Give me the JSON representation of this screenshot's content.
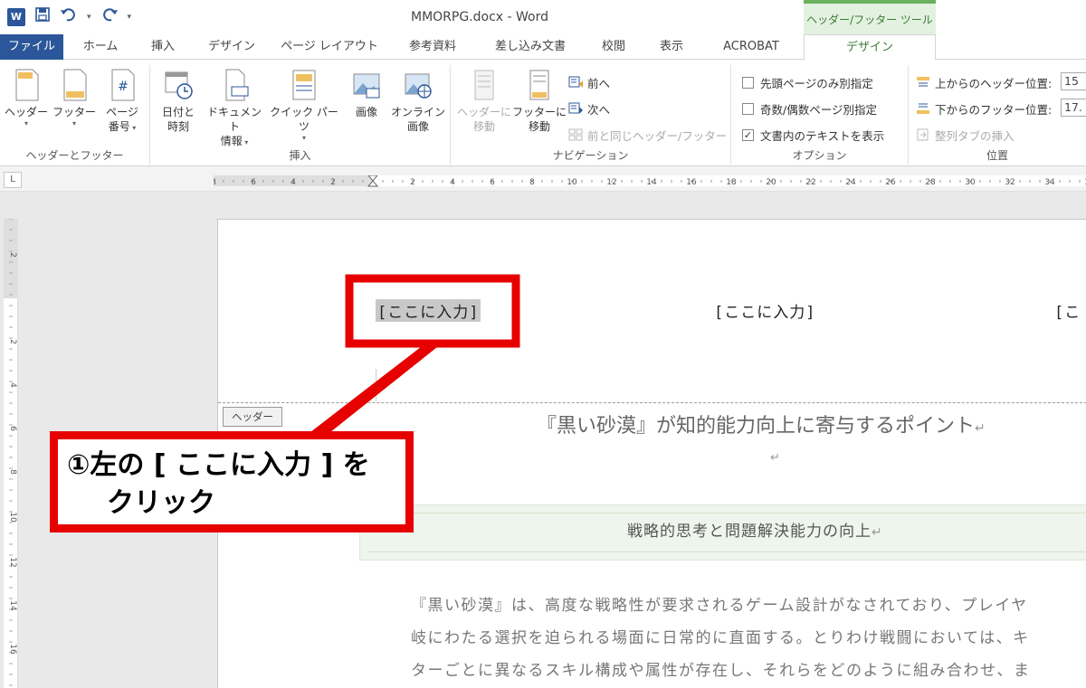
{
  "titlebar": {
    "app_icon": "W",
    "doc_title": "MMORPG.docx - Word",
    "context_title": "ヘッダー/フッター ツール"
  },
  "tabs": [
    {
      "label": "ファイル"
    },
    {
      "label": "ホーム"
    },
    {
      "label": "挿入"
    },
    {
      "label": "デザイン"
    },
    {
      "label": "ページ レイアウト"
    },
    {
      "label": "参考資料"
    },
    {
      "label": "差し込み文書"
    },
    {
      "label": "校閲"
    },
    {
      "label": "表示"
    },
    {
      "label": "ACROBAT"
    },
    {
      "label": "デザイン"
    }
  ],
  "ribbon": {
    "group_hf": {
      "label": "ヘッダーとフッター",
      "header": "ヘッダー",
      "footer": "フッター",
      "page_num_1": "ページ",
      "page_num_2": "番号"
    },
    "group_insert": {
      "label": "挿入",
      "datetime_1": "日付と",
      "datetime_2": "時刻",
      "docinfo_1": "ドキュメント",
      "docinfo_2": "情報",
      "quickparts": "クイック パーツ",
      "picture": "画像",
      "online_1": "オンライン",
      "online_2": "画像"
    },
    "group_nav": {
      "label": "ナビゲーション",
      "goto_header_1": "ヘッダーに",
      "goto_header_2": "移動",
      "goto_footer_1": "フッターに",
      "goto_footer_2": "移動",
      "prev": "前へ",
      "next": "次へ",
      "link_prev": "前と同じヘッダー/フッター"
    },
    "group_options": {
      "label": "オプション",
      "diff_first": "先頭ページのみ別指定",
      "diff_odd_even": "奇数/偶数ページ別指定",
      "show_text": "文書内のテキストを表示",
      "show_text_check": "✓"
    },
    "group_position": {
      "label": "位置",
      "header_pos": "上からのヘッダー位置:",
      "header_val": "15",
      "footer_pos": "下からのフッター位置:",
      "footer_val": "17.",
      "align_tab": "整列タブの挿入"
    }
  },
  "ruler": {
    "corner": "L",
    "h_labels": [
      "8",
      "6",
      "4",
      "2",
      "2",
      "4",
      "6",
      "8",
      "10",
      "12",
      "14",
      "16",
      "18",
      "20",
      "22",
      "24",
      "26",
      "28",
      "30",
      "32",
      "34",
      "36"
    ],
    "v_labels": [
      "2",
      "2",
      "4",
      "6",
      "8",
      "10",
      "12",
      "14",
      "16"
    ]
  },
  "page": {
    "header_left": "[ここに入力]",
    "header_center": "[ここに入力]",
    "header_right": "[こ",
    "header_tag": "ヘッダー",
    "heading": "『黒い砂漠』が知的能力向上に寄与するポイント",
    "para_mark": "↵",
    "section_title": "戦略的思考と問題解決能力の向上",
    "body_lines": [
      "『黒い砂漠』は、高度な戦略性が要求されるゲーム設計がなされており、プレイヤ",
      "岐にわたる選択を迫られる場面に日常的に直面する。とりわけ戦闘においては、キ",
      "ターごとに異なるスキル構成や属性が存在し、それらをどのように組み合わせ、ま"
    ]
  },
  "callout": {
    "line1": "①左の [ ここに入力 ] を",
    "line2": "クリック",
    "color": "#e60000"
  }
}
